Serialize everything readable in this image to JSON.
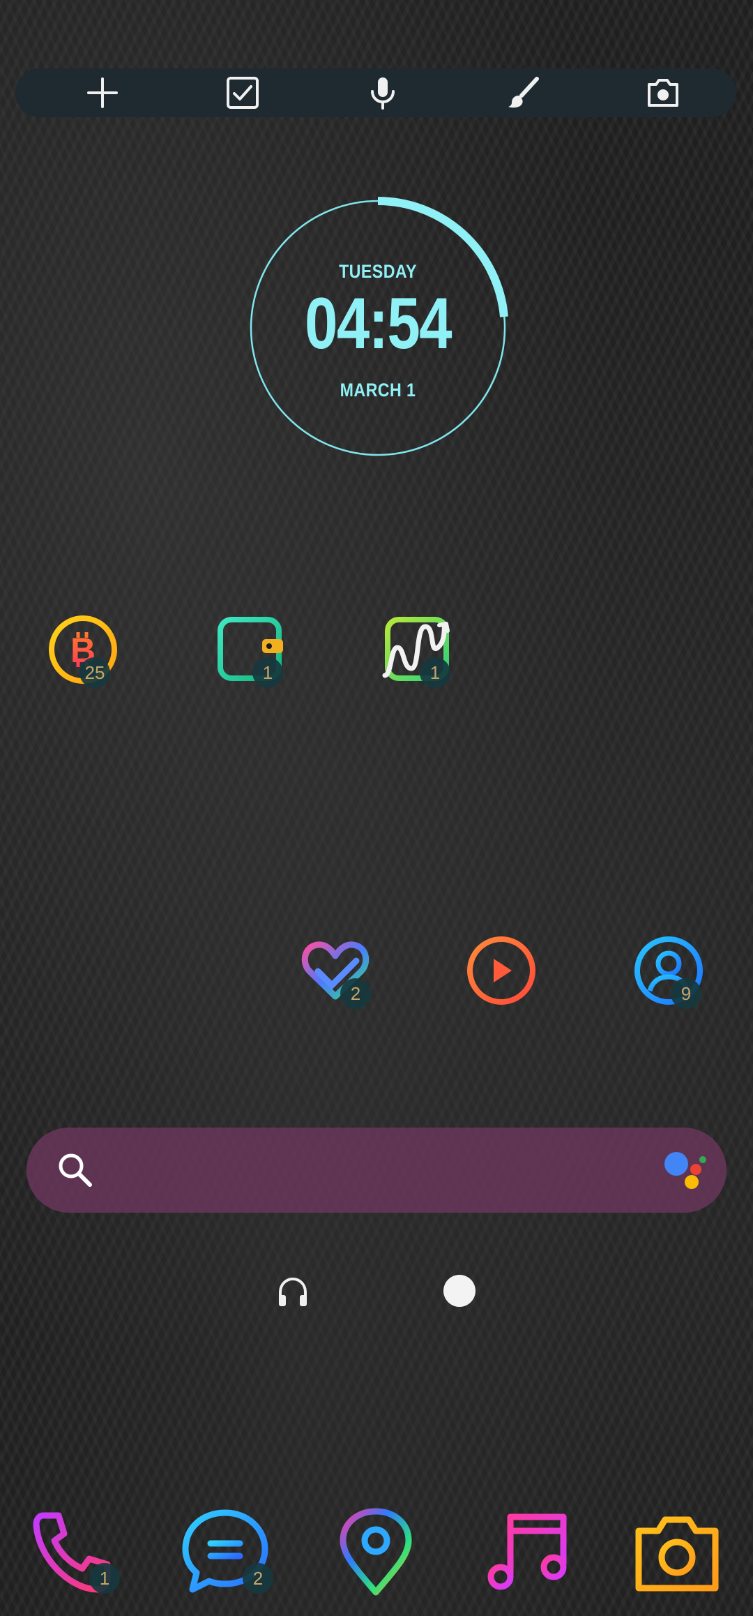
{
  "quick_actions": [
    {
      "name": "add",
      "icon": "plus-icon"
    },
    {
      "name": "task",
      "icon": "checkbox-icon"
    },
    {
      "name": "voice",
      "icon": "microphone-icon"
    },
    {
      "name": "draw",
      "icon": "brush-icon"
    },
    {
      "name": "camera",
      "icon": "camera-icon"
    }
  ],
  "clock": {
    "day": "TUESDAY",
    "time": "04:54",
    "date": "MARCH 1",
    "accent": "#8ff0f5"
  },
  "home_row_1": [
    {
      "app": "bitcoin",
      "icon": "bitcoin-icon",
      "badge": "25"
    },
    {
      "app": "wallet",
      "icon": "wallet-icon",
      "badge": "1"
    },
    {
      "app": "stocks",
      "icon": "stock-chart-icon",
      "badge": "1"
    }
  ],
  "home_row_2": [
    {
      "app": "health",
      "icon": "heart-icon",
      "badge": "2"
    },
    {
      "app": "video",
      "icon": "play-icon",
      "badge": ""
    },
    {
      "app": "contacts",
      "icon": "contacts-icon",
      "badge": "9"
    }
  ],
  "search": {
    "icon": "search-icon",
    "assistant_icon": "google-assistant-icon",
    "background": "#6e375f"
  },
  "page_indicator": {
    "icon": "headphones-icon",
    "active_page": "home"
  },
  "dock": [
    {
      "app": "phone",
      "icon": "phone-icon",
      "badge": "1"
    },
    {
      "app": "messages",
      "icon": "message-icon",
      "badge": "2"
    },
    {
      "app": "maps",
      "icon": "location-pin-icon",
      "badge": ""
    },
    {
      "app": "music",
      "icon": "music-note-icon",
      "badge": ""
    },
    {
      "app": "camera",
      "icon": "camera-icon",
      "badge": ""
    }
  ]
}
